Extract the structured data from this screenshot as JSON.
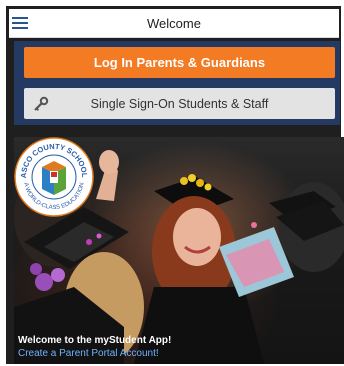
{
  "header": {
    "title": "Welcome",
    "menu_icon": "hamburger-menu-icon"
  },
  "actions": {
    "login_label": "Log In Parents & Guardians",
    "sso_label": "Single Sign-On Students & Staff",
    "sso_icon": "key-icon"
  },
  "hero": {
    "welcome_text": "Welcome to the myStudent App!",
    "create_link": "Create a Parent Portal Account!",
    "seal": {
      "top_text": "PASCO COUNTY SCHOOLS",
      "bottom_text": "A WORLD-CLASS EDUCATION"
    }
  },
  "colors": {
    "accent_orange": "#f37b24",
    "navy": "#243a62",
    "link_blue": "#6fb2ff"
  }
}
